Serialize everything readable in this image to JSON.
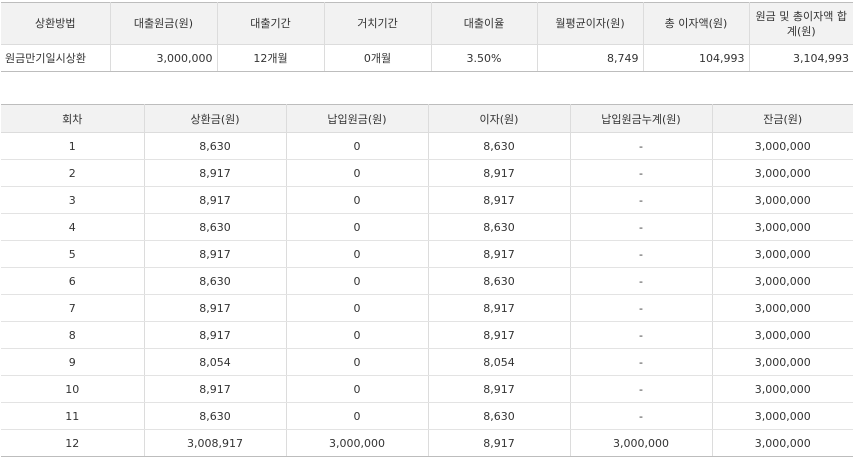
{
  "summary": {
    "headers": [
      "상환방법",
      "대출원금(원)",
      "대출기간",
      "거치기간",
      "대출이율",
      "월평균이자(원)",
      "총 이자액(원)",
      "원금 및 총이자액 합계(원)"
    ],
    "row": {
      "method": "원금만기일시상환",
      "principal": "3,000,000",
      "period": "12개월",
      "grace": "0개월",
      "rate": "3.50%",
      "monthly_interest": "8,749",
      "total_interest": "104,993",
      "total_sum": "3,104,993"
    }
  },
  "schedule": {
    "headers": [
      "회차",
      "상환금(원)",
      "납입원금(원)",
      "이자(원)",
      "납입원금누계(원)",
      "잔금(원)"
    ],
    "rows": [
      [
        "1",
        "8,630",
        "0",
        "8,630",
        "-",
        "3,000,000"
      ],
      [
        "2",
        "8,917",
        "0",
        "8,917",
        "-",
        "3,000,000"
      ],
      [
        "3",
        "8,917",
        "0",
        "8,917",
        "-",
        "3,000,000"
      ],
      [
        "4",
        "8,630",
        "0",
        "8,630",
        "-",
        "3,000,000"
      ],
      [
        "5",
        "8,917",
        "0",
        "8,917",
        "-",
        "3,000,000"
      ],
      [
        "6",
        "8,630",
        "0",
        "8,630",
        "-",
        "3,000,000"
      ],
      [
        "7",
        "8,917",
        "0",
        "8,917",
        "-",
        "3,000,000"
      ],
      [
        "8",
        "8,917",
        "0",
        "8,917",
        "-",
        "3,000,000"
      ],
      [
        "9",
        "8,054",
        "0",
        "8,054",
        "-",
        "3,000,000"
      ],
      [
        "10",
        "8,917",
        "0",
        "8,917",
        "-",
        "3,000,000"
      ],
      [
        "11",
        "8,630",
        "0",
        "8,630",
        "-",
        "3,000,000"
      ],
      [
        "12",
        "3,008,917",
        "3,000,000",
        "8,917",
        "3,000,000",
        "3,000,000"
      ]
    ]
  }
}
